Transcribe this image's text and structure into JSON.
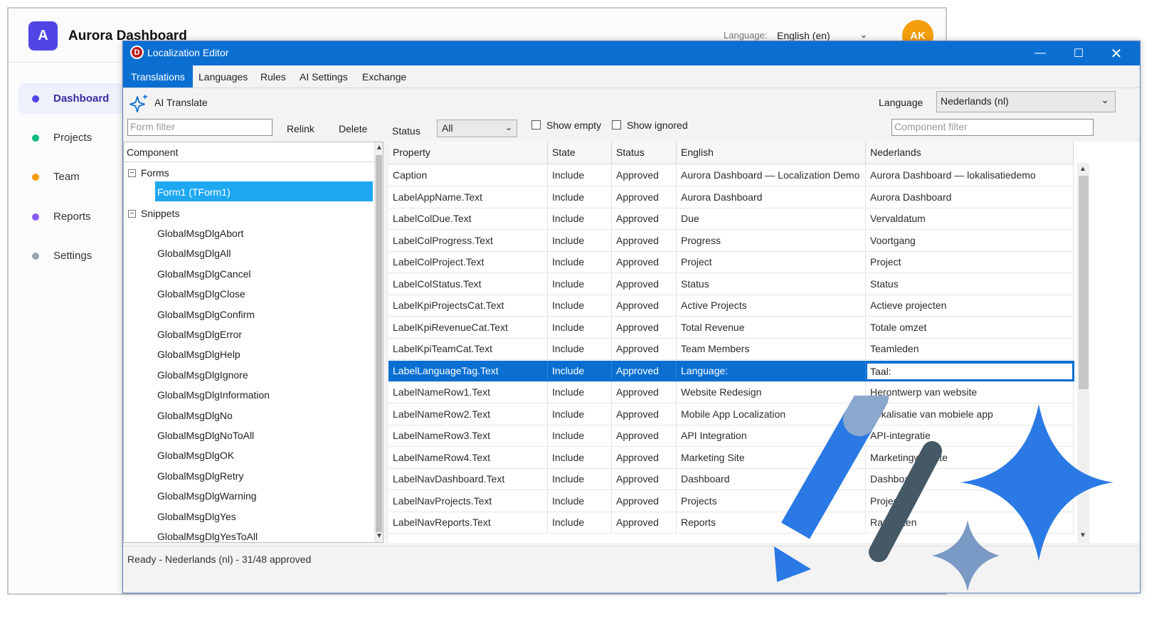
{
  "background_app": {
    "logo_letter": "A",
    "title": "Aurora Dashboard",
    "language_label": "Language:",
    "language_value": "English (en)",
    "avatar_initials": "AK",
    "nav": [
      {
        "label": "Dashboard",
        "color": "#4f46e5",
        "active": true
      },
      {
        "label": "Projects",
        "color": "#10b981"
      },
      {
        "label": "Team",
        "color": "#f59e0b"
      },
      {
        "label": "Reports",
        "color": "#8b5cf6"
      },
      {
        "label": "Settings",
        "color": "#9ca3af"
      }
    ]
  },
  "editor": {
    "title": "Localization Editor",
    "app_icon_letter": "D",
    "tabs": [
      {
        "label": "Translations",
        "active": true
      },
      {
        "label": "Languages"
      },
      {
        "label": "Rules"
      },
      {
        "label": "AI Settings"
      },
      {
        "label": "Exchange"
      }
    ],
    "ai_translate_label": "AI Translate",
    "language_label": "Language",
    "language_value": "Nederlands (nl)",
    "form_filter_placeholder": "Form filter",
    "relink_label": "Relink",
    "delete_label": "Delete",
    "status_label": "Status",
    "status_value": "All",
    "show_empty_label": "Show empty",
    "show_ignored_label": "Show ignored",
    "component_filter_placeholder": "Component filter",
    "tree": {
      "header": "Component",
      "forms_label": "Forms",
      "form_item": "Form1 (TForm1)",
      "snippets_label": "Snippets",
      "snippets": [
        "GlobalMsgDlgAbort",
        "GlobalMsgDlgAll",
        "GlobalMsgDlgCancel",
        "GlobalMsgDlgClose",
        "GlobalMsgDlgConfirm",
        "GlobalMsgDlgError",
        "GlobalMsgDlgHelp",
        "GlobalMsgDlgIgnore",
        "GlobalMsgDlgInformation",
        "GlobalMsgDlgNo",
        "GlobalMsgDlgNoToAll",
        "GlobalMsgDlgOK",
        "GlobalMsgDlgRetry",
        "GlobalMsgDlgWarning",
        "GlobalMsgDlgYes",
        "GlobalMsgDlgYesToAll"
      ]
    },
    "grid": {
      "columns": [
        "Property",
        "State",
        "Status",
        "English",
        "Nederlands"
      ],
      "selected_row": 9,
      "rows": [
        [
          "Caption",
          "Include",
          "Approved",
          "Aurora Dashboard — Localization Demo",
          "Aurora Dashboard — lokalisatiedemo"
        ],
        [
          "LabelAppName.Text",
          "Include",
          "Approved",
          "Aurora Dashboard",
          "Aurora Dashboard"
        ],
        [
          "LabelColDue.Text",
          "Include",
          "Approved",
          "Due",
          "Vervaldatum"
        ],
        [
          "LabelColProgress.Text",
          "Include",
          "Approved",
          "Progress",
          "Voortgang"
        ],
        [
          "LabelColProject.Text",
          "Include",
          "Approved",
          "Project",
          "Project"
        ],
        [
          "LabelColStatus.Text",
          "Include",
          "Approved",
          "Status",
          "Status"
        ],
        [
          "LabelKpiProjectsCat.Text",
          "Include",
          "Approved",
          "Active Projects",
          "Actieve projecten"
        ],
        [
          "LabelKpiRevenueCat.Text",
          "Include",
          "Approved",
          "Total Revenue",
          "Totale omzet"
        ],
        [
          "LabelKpiTeamCat.Text",
          "Include",
          "Approved",
          "Team Members",
          "Teamleden"
        ],
        [
          "LabelLanguageTag.Text",
          "Include",
          "Approved",
          "Language:",
          "Taal:"
        ],
        [
          "LabelNameRow1.Text",
          "Include",
          "Approved",
          "Website Redesign",
          "Herontwerp van website"
        ],
        [
          "LabelNameRow2.Text",
          "Include",
          "Approved",
          "Mobile App Localization",
          "Lokalisatie van mobiele app"
        ],
        [
          "LabelNameRow3.Text",
          "Include",
          "Approved",
          "API Integration",
          "API-integratie"
        ],
        [
          "LabelNameRow4.Text",
          "Include",
          "Approved",
          "Marketing Site",
          "Marketingwebsite"
        ],
        [
          "LabelNavDashboard.Text",
          "Include",
          "Approved",
          "Dashboard",
          "Dashboard"
        ],
        [
          "LabelNavProjects.Text",
          "Include",
          "Approved",
          "Projects",
          "Projecten"
        ],
        [
          "LabelNavReports.Text",
          "Include",
          "Approved",
          "Reports",
          "Rapporten"
        ]
      ]
    },
    "status_bar": "Ready - Nederlands (nl) - 31/48 approved"
  },
  "colors": {
    "titlebar": "#0b6fd2",
    "selection": "#0b6fd2",
    "tree_selection": "#1fa8f2",
    "pencil": "#2a79e4",
    "sparkle_large": "#2a79e4",
    "sparkle_small": "#7a99c4",
    "slash": "#445866"
  },
  "overlay_icons": [
    "pencil-icon",
    "slash-icon",
    "sparkle-icon"
  ]
}
